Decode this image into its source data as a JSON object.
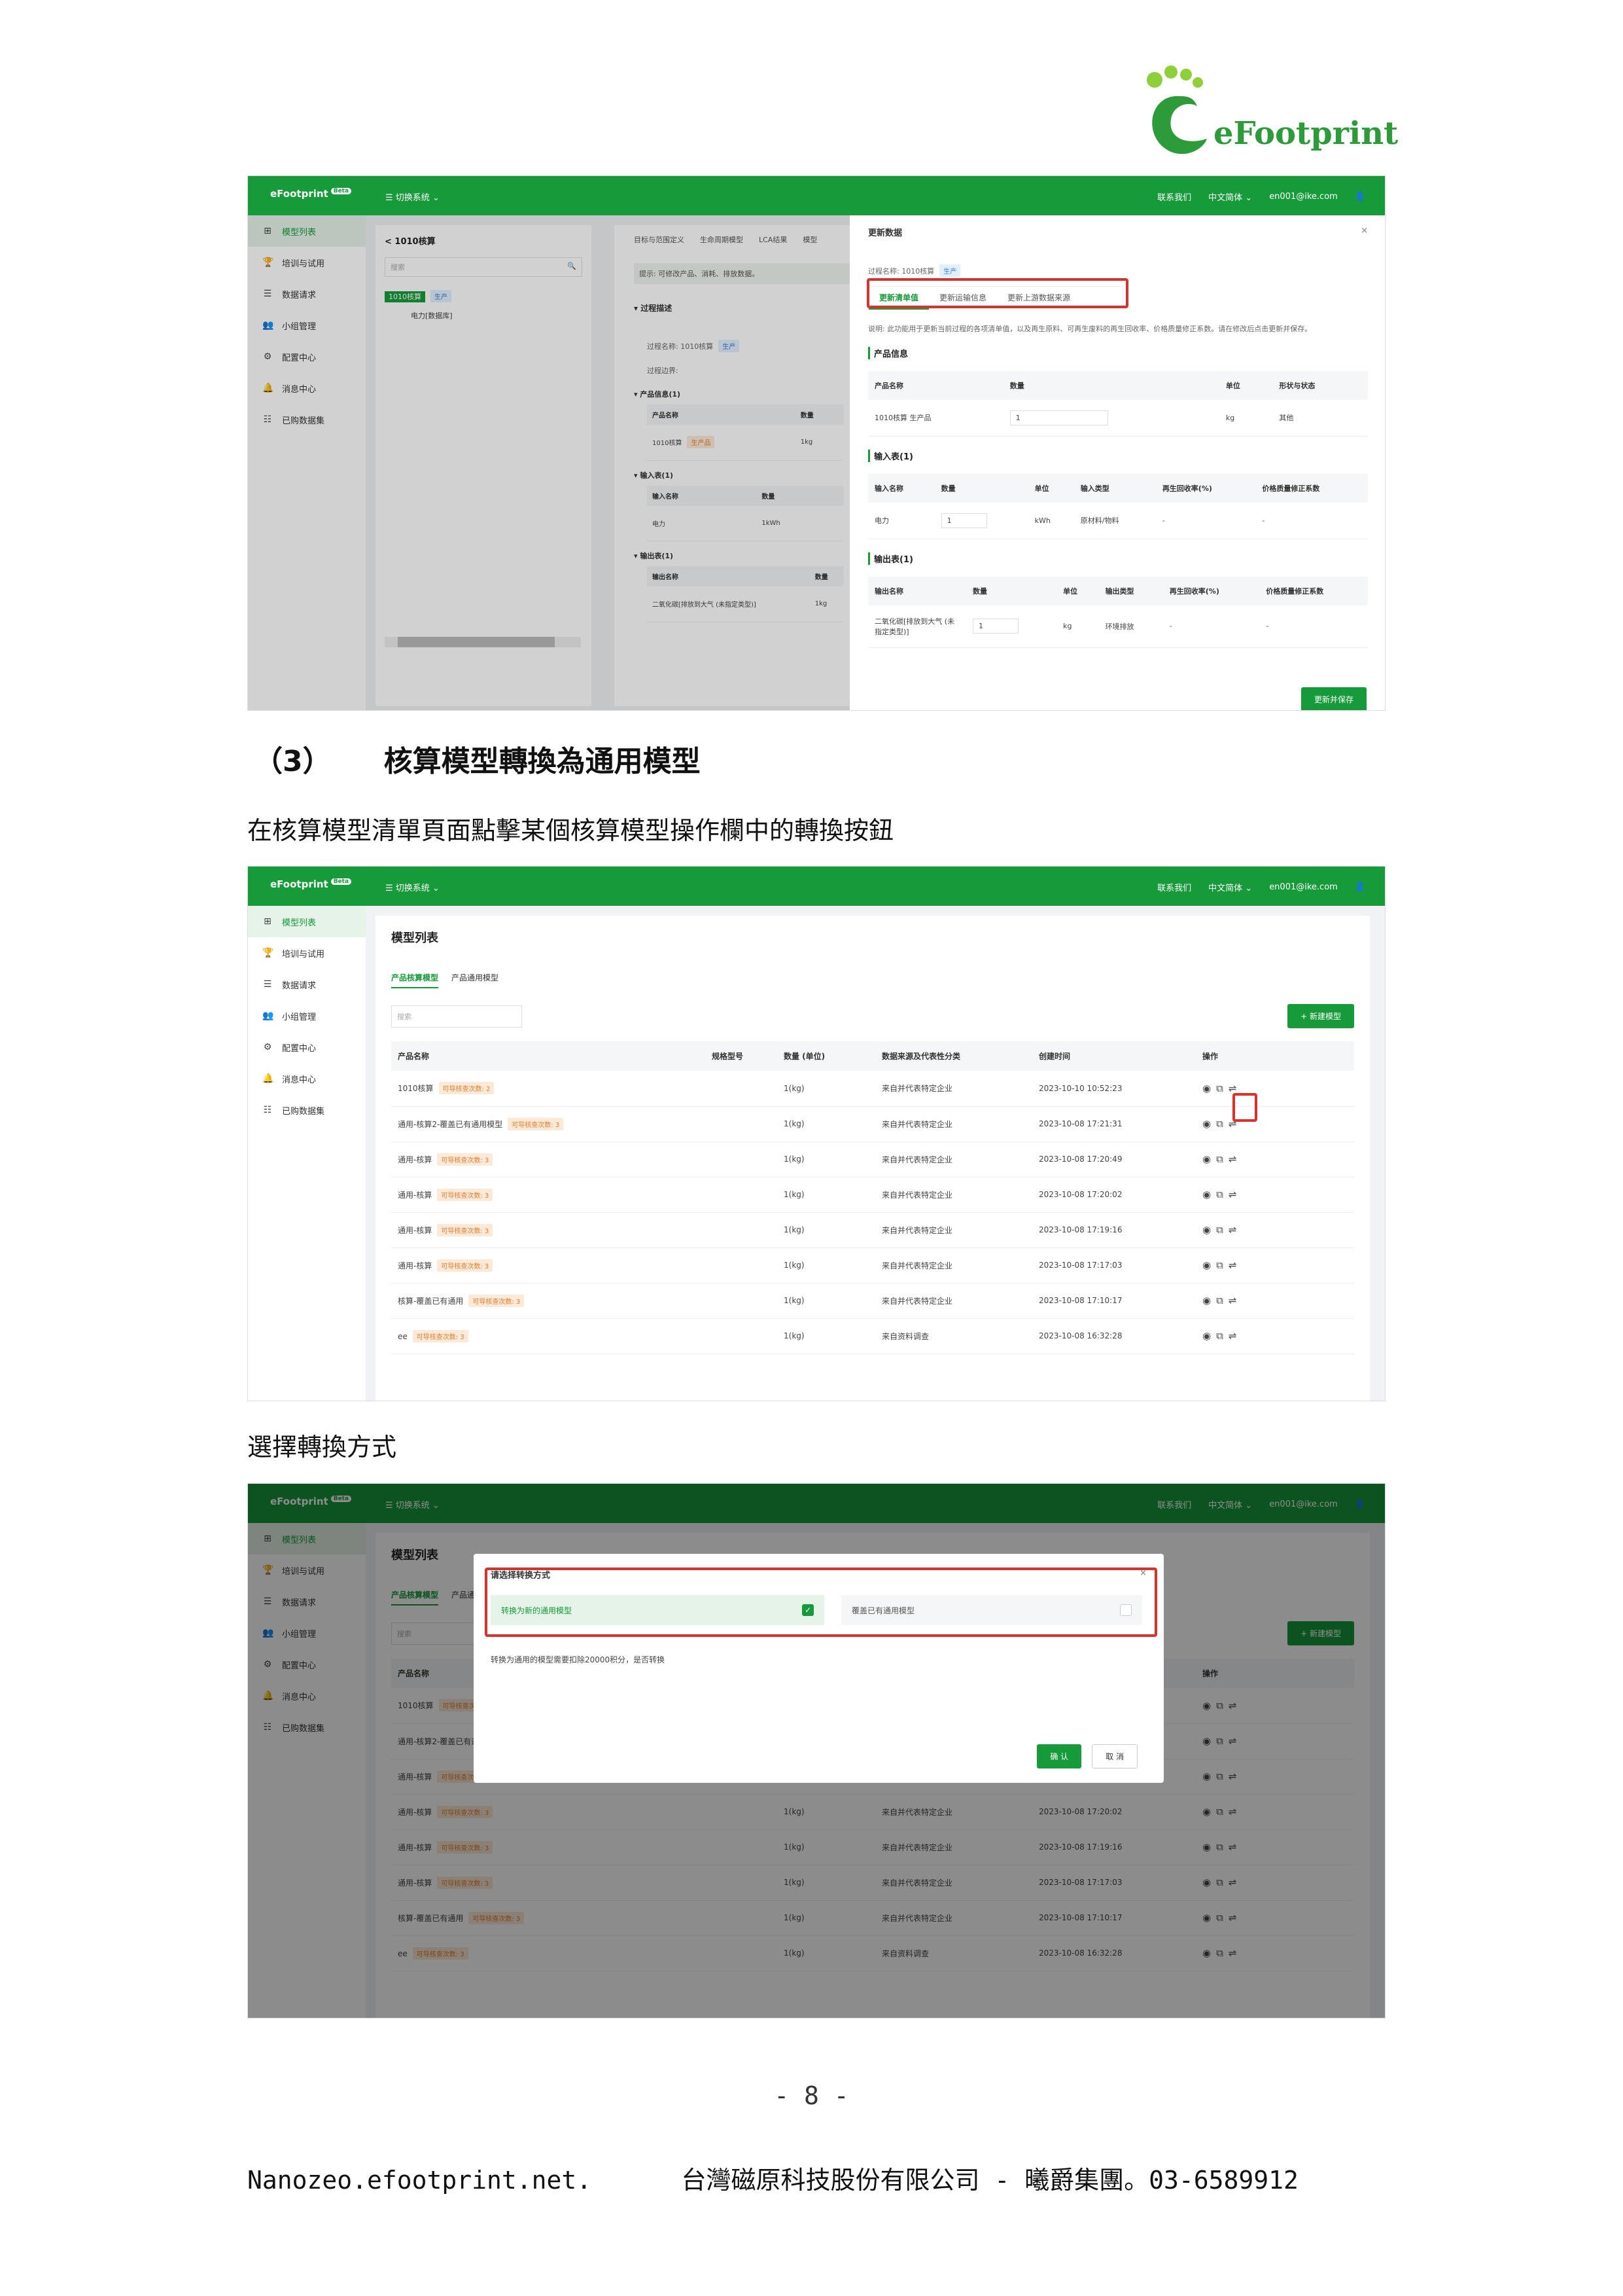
{
  "logo": {
    "text": "eFootprint"
  },
  "app": {
    "brand": "eFootprint",
    "beta": "Beta",
    "switch": "切换系统",
    "contact": "联系我们",
    "lang": "中文简体",
    "user": "en001@ike.com"
  },
  "sidebar": [
    "模型列表",
    "培训与试用",
    "数据请求",
    "小组管理",
    "配置中心",
    "消息中心",
    "已购数据集"
  ],
  "shot1": {
    "back": "< 1010核算",
    "search_placeholder": "搜索",
    "tree_root": "1010核算",
    "tree_root_tag": "生产",
    "tree_child": "电力[数据库]",
    "top_tabs": [
      "目标与范围定义",
      "生命周期模型",
      "LCA结果",
      "模型"
    ],
    "hint": "提示: 可修改产品、消耗、排放数据。",
    "section_process": "过程描述",
    "process_name_label": "过程名称: 1010核算",
    "process_name_tag": "生产",
    "boundary_label": "过程边界:",
    "product_info": "产品信息(1)",
    "input_table": "输入表(1)",
    "output_table": "输出表(1)",
    "mid_product_headers": [
      "产品名称",
      "数量"
    ],
    "mid_product_row": [
      "1010核算",
      "1kg"
    ],
    "mid_product_tag": "生产品",
    "mid_input_headers": [
      "输入名称",
      "数量"
    ],
    "mid_input_row": [
      "电力",
      "1kWh"
    ],
    "mid_output_headers": [
      "输出名称",
      "数量"
    ],
    "mid_output_row": [
      "二氧化碳[排放到大气 (未指定类型)]",
      "1kg"
    ],
    "dialog": {
      "title": "更新数据",
      "close": "×",
      "process_name": "过程名称: 1010核算",
      "process_tag": "生产",
      "tabs": [
        "更新清单值",
        "更新运输信息",
        "更新上游数据来源"
      ],
      "note": "说明: 此功能用于更新当前过程的各项清单值，以及再生原料、可再生废料的再生回收率、价格质量修正系数。请在修改后点击更新并保存。",
      "product_section": "产品信息",
      "product_headers": [
        "产品名称",
        "数量",
        "单位",
        "形状与状态"
      ],
      "product_row": [
        "1010核算 生产品",
        "1",
        "kg",
        "其他"
      ],
      "input_section": "输入表(1)",
      "input_headers": [
        "输入名称",
        "数量",
        "单位",
        "输入类型",
        "再生回收率(%)",
        "价格质量修正系数"
      ],
      "input_row": [
        "电力",
        "1",
        "kWh",
        "原材料/物料",
        "-",
        "-"
      ],
      "output_section": "输出表(1)",
      "output_headers": [
        "输出名称",
        "数量",
        "单位",
        "输出类型",
        "再生回收率(%)",
        "价格质量修正系数"
      ],
      "output_row": [
        "二氧化碳[排放到大气 (未指定类型)]",
        "1",
        "kg",
        "环境排放",
        "-",
        "-"
      ],
      "save": "更新并保存"
    }
  },
  "heading": {
    "num": "（3）",
    "title": "核算模型轉換為通用模型"
  },
  "para1": "在核算模型清單頁面點擊某個核算模型操作欄中的轉換按鈕",
  "para2": "選擇轉換方式",
  "list": {
    "title": "模型列表",
    "tabs": [
      "产品核算模型",
      "产品通用模型"
    ],
    "search_placeholder": "搜索",
    "new_btn": "+ 新建模型",
    "headers": [
      "产品名称",
      "规格型号",
      "数量 (单位)",
      "数据来源及代表性分类",
      "创建时间",
      "操作"
    ],
    "tag_text": "可导核查次数",
    "rows": [
      {
        "name": "1010核算",
        "tag": "可导核查次数: 2",
        "qty": "1(kg)",
        "src": "来自并代表特定企业",
        "time": "2023-10-10 10:52:23"
      },
      {
        "name": "通用-核算2-覆盖已有通用模型",
        "tag": "可导核查次数: 3",
        "qty": "1(kg)",
        "src": "来自并代表特定企业",
        "time": "2023-10-08 17:21:31"
      },
      {
        "name": "通用-核算",
        "tag": "可导核查次数: 3",
        "qty": "1(kg)",
        "src": "来自并代表特定企业",
        "time": "2023-10-08 17:20:49"
      },
      {
        "name": "通用-核算",
        "tag": "可导核查次数: 3",
        "qty": "1(kg)",
        "src": "来自并代表特定企业",
        "time": "2023-10-08 17:20:02"
      },
      {
        "name": "通用-核算",
        "tag": "可导核查次数: 3",
        "qty": "1(kg)",
        "src": "来自并代表特定企业",
        "time": "2023-10-08 17:19:16"
      },
      {
        "name": "通用-核算",
        "tag": "可导核查次数: 3",
        "qty": "1(kg)",
        "src": "来自并代表特定企业",
        "time": "2023-10-08 17:17:03"
      },
      {
        "name": "核算-覆盖已有通用",
        "tag": "可导核查次数: 3",
        "qty": "1(kg)",
        "src": "来自并代表特定企业",
        "time": "2023-10-08 17:10:17"
      },
      {
        "name": "ee",
        "tag": "可导核查次数: 3",
        "qty": "1(kg)",
        "src": "来自资料调查",
        "time": "2023-10-08 16:32:28"
      }
    ]
  },
  "convert_dialog": {
    "title": "请选择转换方式",
    "close": "×",
    "option1": "转换为新的通用模型",
    "option2": "覆盖已有通用模型",
    "message": "转换为通用的模型需要扣除20000积分，是否转换",
    "ok": "确 认",
    "cancel": "取 消"
  },
  "page_number": "- 8 -",
  "footer": "Nanozeo.efootprint.net.      台灣磁原科技股份有限公司 - 曦爵集團。03-6589912"
}
